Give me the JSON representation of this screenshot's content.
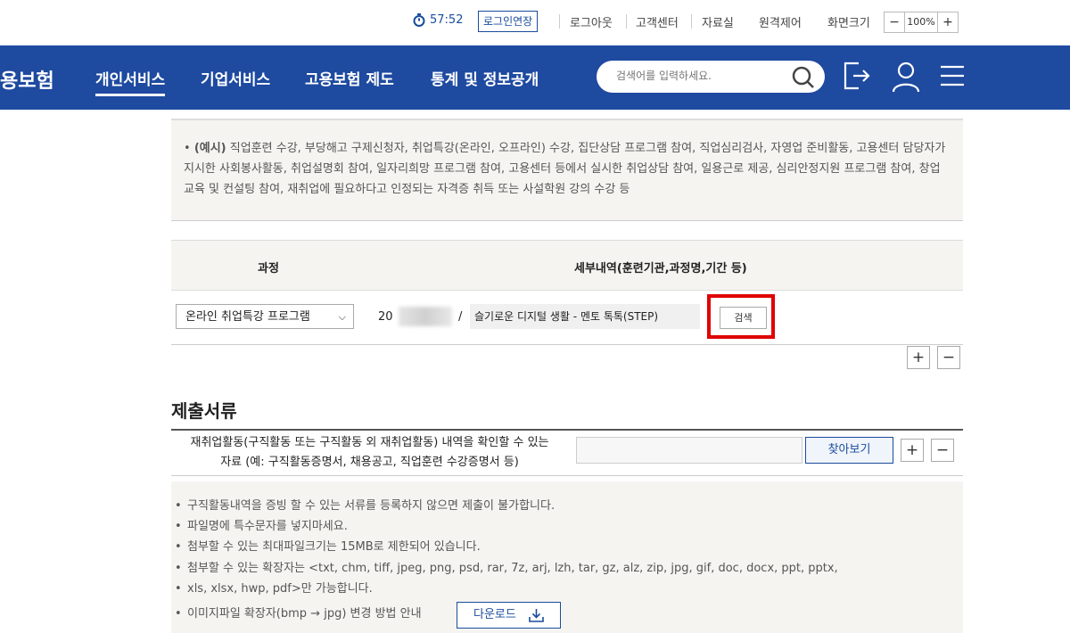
{
  "top_utility": {
    "timer": "57:52",
    "extend_login": "로그인연장",
    "logout": "로그아웃",
    "customer_center": "고객센터",
    "archive": "자료실",
    "remote_control": "원격제어",
    "screen_size_label": "화면크기",
    "zoom_minus": "−",
    "zoom_value": "100%",
    "zoom_plus": "+"
  },
  "navbar": {
    "brand": "용보험",
    "items": [
      "개인서비스",
      "기업서비스",
      "고용보험 제도",
      "통계 및 정보공개"
    ],
    "active_index": 0,
    "search_placeholder": "검색어를 입력하세요."
  },
  "example": {
    "text_bold": "(예시)",
    "text": " 직업훈련 수강, 부당해고 구제신청자, 취업특강(온라인, 오프라인) 수강, 집단상담 프로그램 참여, 직업심리검사, 자영업 준비활동, 고용센터 담당자가 지시한 사회봉사활동, 취업설명회 참여, 일자리희망 프로그램 참여, 고용센터 등에서 실시한 취업상담 참여, 일용근로 제공, 심리안정지원 프로그램 참여, 창업교육 및 컨설팅 참여, 재취업에 필요하다고 인정되는 자격증 취득 또는 사설학원 강의 수강 등"
  },
  "course_table": {
    "headers": [
      "과정",
      "세부내역(훈련기관,과정명,기간 등)"
    ],
    "row": {
      "course_select": "온라인 취업특강 프로그램",
      "date_prefix": "20",
      "slash": "/",
      "course_name": "슬기로운 디지털 생활 - 멘토 톡톡(STEP)",
      "search_button": "검색"
    },
    "add": "+",
    "remove": "−"
  },
  "documents": {
    "title": "제출서류",
    "label_line1": "재취업활동(구직활동 또는 구직활동 외 재취업활동) 내역을 확인할 수 있는",
    "label_line2": "자료 (예: 구직활동증명서, 채용공고, 직업훈련 수강증명서 등)",
    "find_button": "찾아보기",
    "add": "+",
    "remove": "−"
  },
  "notices": [
    "구직활동내역을 증빙 할 수 있는 서류를 등록하지 않으면 제출이 불가합니다.",
    "파일명에 특수문자를 넣지마세요.",
    "첨부할 수 있는 최대파일크기는 15MB로 제한되어 있습니다.",
    "첨부할 수 있는 확장자는 <txt, chm, tiff, jpeg, png, psd, rar, 7z, arj, lzh, tar, gz, alz, zip, jpg, gif, doc, docx, ppt, pptx,",
    "xls, xlsx, hwp, pdf>만 가능합니다.",
    "이미지파일 확장자(bmp → jpg) 변경 방법 안내"
  ],
  "download_button": "다운로드",
  "colors": {
    "nav_bg": "#1e4aa0",
    "accent": "#1a4c9c",
    "highlight": "#e00000"
  }
}
